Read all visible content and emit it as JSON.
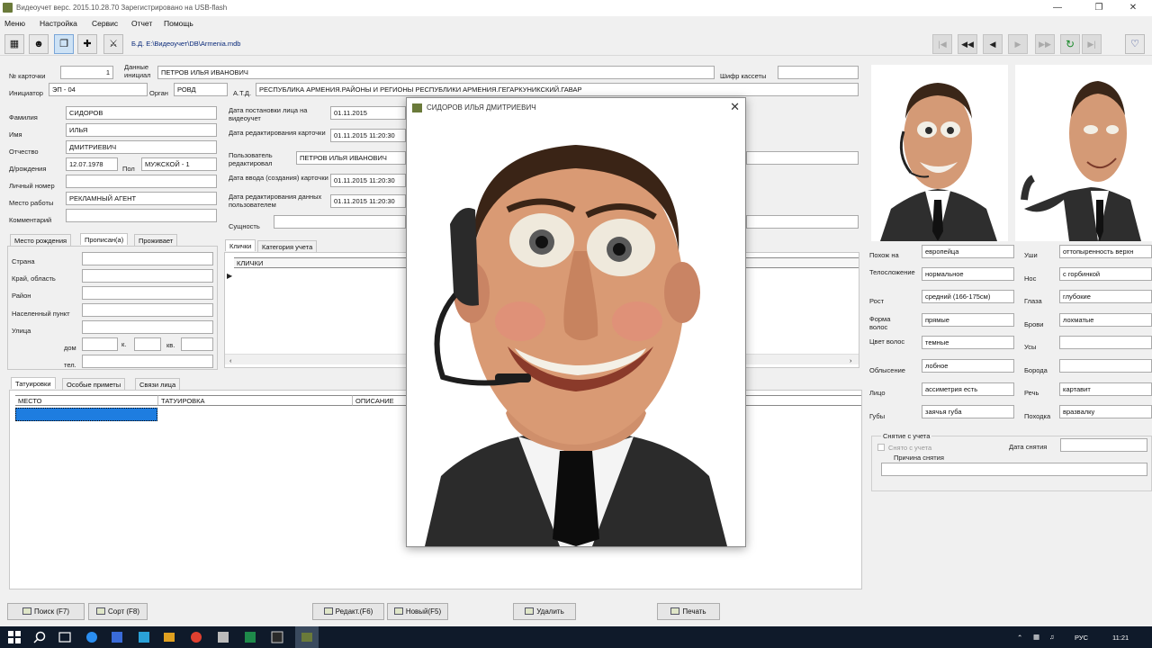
{
  "window": {
    "title": "Видеоучет верс. 2015.10.28.70  Зарегистрировано на USB-flash",
    "db_path": "Б.Д. E:\\Видеоучет\\DB\\Armenia.mdb"
  },
  "menu": [
    "Меню",
    "Настройка",
    "Сервис",
    "Отчет",
    "Помощь"
  ],
  "left_form": {
    "card_no_label": "№ карточки",
    "card_no": "1",
    "source_data_label": "Данные инициал",
    "source_data": "ПЕТРОВ ИЛЬЯ ИВАНОВИЧ",
    "cassette_label": "Шифр кассеты",
    "cassette": "",
    "initiator_label": "Инициатор",
    "initiator": "ЭП - 04",
    "organ_label": "Орган",
    "organ": "РОВД",
    "atd_label": "А.Т.Д.",
    "atd": "РЕСПУБЛИКА АРМЕНИЯ.РАЙОНЫ И РЕГИОНЫ РЕСПУБЛИКИ АРМЕНИЯ.ГЕГАРКУНИКСКИЙ.ГАВАР",
    "surname_label": "Фамилия",
    "surname": "СИДОРОВ",
    "name_label": "Имя",
    "name": "ИЛЬЯ",
    "patronymic_label": "Отчество",
    "patronymic": "ДМИТРИЕВИЧ",
    "birth_label": "Д/рождения",
    "birth": "12.07.1978",
    "sex_label": "Пол",
    "sex": "МУЖСКОЙ - 1",
    "personal_no_label": "Личный номер",
    "personal_no": "",
    "workplace_label": "Место работы",
    "workplace": "РЕКЛАМНЫЙ АГЕНТ",
    "comments_label": "Комментарий",
    "comments": ""
  },
  "mid_form": {
    "registered_label": "Дата постановки лица на видеоучет",
    "registered": "01.11.2015",
    "edited_label": "Дата редактирования карточки",
    "edited": "01.11.2015 11:20:30",
    "user_label": "Пользователь редактировал",
    "user": "ПЕТРОВ ИЛЬЯ ИВАНОВИЧ",
    "created_label": "Дата ввода (создания) карточки",
    "created": "01.11.2015 11:20:30",
    "user_edit_label": "Дата редактирования данных пользователем",
    "user_edit": "01.11.2015 11:20:30",
    "essence_label": "Сущность",
    "essence": ""
  },
  "addr_tabs": [
    "Место рождения",
    "Прописан(а)",
    "Проживает"
  ],
  "addr_fields": {
    "country": "Страна",
    "region": "Край, область",
    "district": "Район",
    "settlement": "Населенный пункт",
    "street": "Улица",
    "house": "дом",
    "korp": "к.",
    "apt": "кв.",
    "phone": "тел."
  },
  "nick_tabs": [
    "Клички",
    "Категория учета"
  ],
  "nick_header": "КЛИЧКИ",
  "tattoo_tabs": [
    "Татуировки",
    "Особые приметы",
    "Связи лица"
  ],
  "tattoo_columns": [
    "МЕСТО",
    "ТАТУИРОВКА",
    "ОПИСАНИЕ"
  ],
  "popup": {
    "title": "СИДОРОВ  ИЛЬЯ  ДМИТРИЕВИЧ"
  },
  "features_left": [
    {
      "label": "Похож на",
      "value": "европейца"
    },
    {
      "label": "Телосложение",
      "value": "нормальное"
    },
    {
      "label": "Рост",
      "value": "средний (166-175см)"
    },
    {
      "label": "Форма волос",
      "value": "прямые"
    },
    {
      "label": "Цвет волос",
      "value": "темные"
    },
    {
      "label": "Облысение",
      "value": "лобное"
    },
    {
      "label": "Лицо",
      "value": "ассиметрия есть"
    },
    {
      "label": "Губы",
      "value": "заячья губа"
    }
  ],
  "features_right": [
    {
      "label": "Уши",
      "value": "оттопыренность верхн"
    },
    {
      "label": "Нос",
      "value": "с горбинкой"
    },
    {
      "label": "Глаза",
      "value": "глубокие"
    },
    {
      "label": "Брови",
      "value": "лохматые"
    },
    {
      "label": "Усы",
      "value": ""
    },
    {
      "label": "Борода",
      "value": ""
    },
    {
      "label": "Речь",
      "value": "картавит"
    },
    {
      "label": "Походка",
      "value": "вразвалку"
    }
  ],
  "removal": {
    "group": "Снятие с учета",
    "checkbox": "Снято с учета",
    "date_label": "Дата снятия",
    "reason_label": "Причина снятия"
  },
  "bottom_buttons": {
    "search": "Поиск (F7)",
    "sort": "Сорт (F8)",
    "edit": "Редакт.(F6)",
    "new": "Новый(F5)",
    "delete": "Удалить",
    "print": "Печать"
  },
  "taskbar": {
    "lang": "РУС",
    "time": "11:21"
  }
}
